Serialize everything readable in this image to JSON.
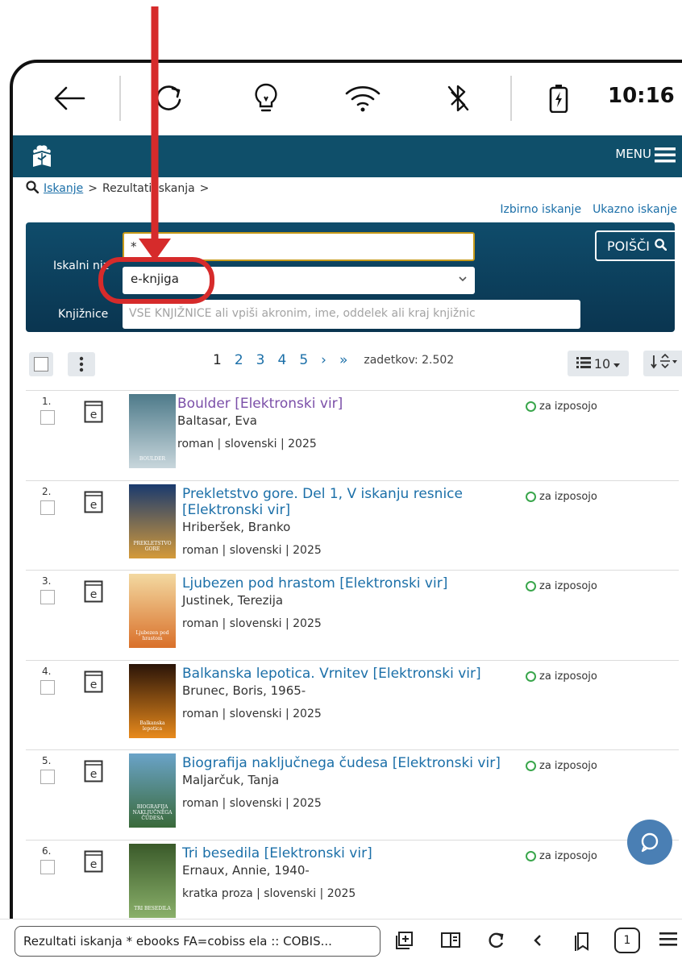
{
  "status_bar": {
    "time": "10:16"
  },
  "header": {
    "menu_label": "MENU"
  },
  "breadcrumb": {
    "search_link": "Iskanje",
    "separator": ">",
    "current": "Rezultati iskanja",
    "trailing": ">"
  },
  "search_links": {
    "advanced": "Izbirno iskanje",
    "command": "Ukazno iskanje"
  },
  "search": {
    "query_label": "Iskalni niz",
    "query_value": "*",
    "type_value": "e-knjiga",
    "libraries_label": "Knjižnice",
    "libraries_placeholder": "VSE KNJIŽNICE ali vpiši akronim, ime, oddelek ali kraj knjižnic",
    "button_label": "POIŠČI"
  },
  "toolbar": {
    "pages": [
      "1",
      "2",
      "3",
      "4",
      "5"
    ],
    "current_page": "1",
    "next": "›",
    "last": "»",
    "hits_label": "zadetkov: 2.502",
    "per_page": "10"
  },
  "results": [
    {
      "num": "1.",
      "title": "Boulder [Elektronski vir]",
      "author": "Baltasar, Eva",
      "meta": "roman | slovenski | 2025",
      "availability": "za izposojo",
      "cover_text": "BOULDER",
      "cover_colors": [
        "#4e7a8a",
        "#c8d6dc"
      ]
    },
    {
      "num": "2.",
      "title": "Prekletstvo gore. Del 1, V iskanju resnice [Elektronski vir]",
      "author": "Hriberšek, Branko",
      "meta": "roman | slovenski | 2025",
      "availability": "za izposojo",
      "cover_text": "PREKLETSTVO GORE",
      "cover_colors": [
        "#1a3a6e",
        "#d49a3a"
      ]
    },
    {
      "num": "3.",
      "title": "Ljubezen pod hrastom [Elektronski vir]",
      "author": "Justinek, Terezija",
      "meta": "roman | slovenski | 2025",
      "availability": "za izposojo",
      "cover_text": "Ljubezen pod hrastom",
      "cover_colors": [
        "#f3d9a1",
        "#d9702a"
      ]
    },
    {
      "num": "4.",
      "title": "Balkanska lepotica. Vrnitev [Elektronski vir]",
      "author": "Brunec, Boris, 1965-",
      "meta": "roman | slovenski | 2025",
      "availability": "za izposojo",
      "cover_text": "Balkanska lepotica",
      "cover_colors": [
        "#2a1408",
        "#e88a1c"
      ]
    },
    {
      "num": "5.",
      "title": "Biografija naključnega čudesa [Elektronski vir]",
      "author": "Maljarčuk, Tanja",
      "meta": "roman | slovenski | 2025",
      "availability": "za izposojo",
      "cover_text": "BIOGRAFIJA NAKLJUČNEGA ČUDESA",
      "cover_colors": [
        "#6aa3c8",
        "#3a6a3a"
      ]
    },
    {
      "num": "6.",
      "title": "Tri besedila [Elektronski vir]",
      "author": "Ernaux, Annie, 1940-",
      "meta": "kratka proza | slovenski | 2025",
      "availability": "za izposojo",
      "cover_text": "TRI BESEDILA",
      "cover_colors": [
        "#3a5a2a",
        "#8ab06a"
      ]
    }
  ],
  "browser": {
    "url_title": "Rezultati iskanja * ebooks FA=cobiss ela :: COBIS...",
    "tab_count": "1"
  },
  "colors": {
    "header": "#0f4f6a",
    "link": "#1b6fa8",
    "available": "#3aa64c",
    "annotation": "#d62b2b"
  }
}
